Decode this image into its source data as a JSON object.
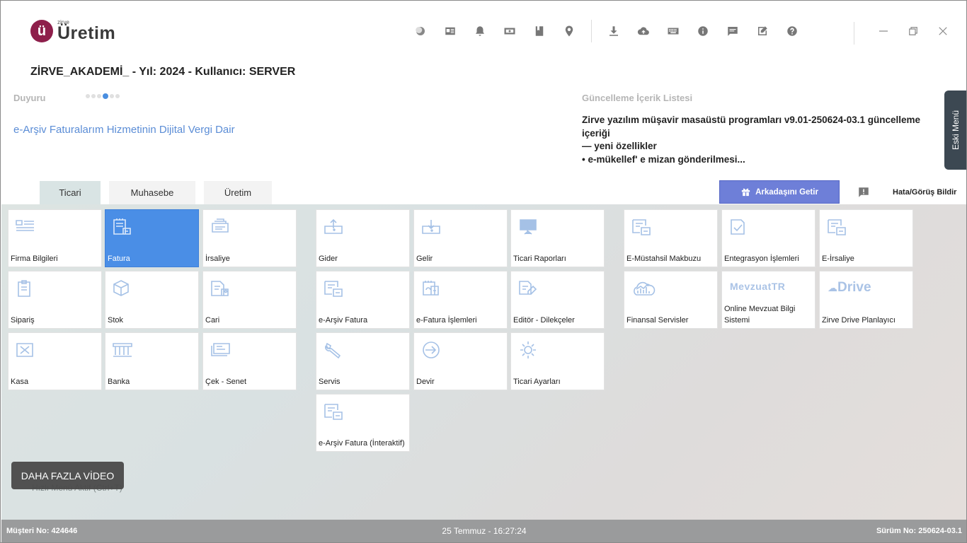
{
  "app": {
    "logo_small": "zirve",
    "logo_main": "Üretim",
    "logo_badge": "ü"
  },
  "topbar_icons": [
    "theme-icon",
    "news-icon",
    "bell-icon",
    "money-icon",
    "bookmark-icon",
    "location-icon"
  ],
  "topbar_icons2": [
    "download-icon",
    "cloud-upload-icon",
    "keyboard-icon",
    "info-icon",
    "chat-icon",
    "edit-icon",
    "help-icon"
  ],
  "company_line": "ZİRVE_AKADEMİ_ - Yıl: 2024 - Kullanıcı: SERVER",
  "duyuru": {
    "label": "Duyuru",
    "link": "e-Arşiv Faturalarım Hizmetinin Dijital Vergi Dair"
  },
  "guncelleme": {
    "title": "Güncelleme İçerik Listesi",
    "lines": [
      "Zirve yazılım müşavir masaüstü programları v9.01-250624-03.1 güncelleme içeriği",
      "— yeni özellikler",
      "• e-mükellef' e mizan gönderilmesi..."
    ]
  },
  "eski_menu": "Eski Menü",
  "tabs": [
    "Ticari",
    "Muhasebe",
    "Üretim"
  ],
  "arkadas_button": "Arkadaşını Getir",
  "hata_link": "Hata/Görüş Bildir",
  "tiles": {
    "firma": "Firma Bilgileri",
    "fatura": "Fatura",
    "irsaliye": "İrsaliye",
    "siparis": "Sipariş",
    "stok": "Stok",
    "cari": "Cari",
    "kasa": "Kasa",
    "banka": "Banka",
    "cek": "Çek - Senet",
    "gider": "Gider",
    "gelir": "Gelir",
    "ticari_raporlar": "Ticari Raporları",
    "earsiv": "e-Arşiv Fatura",
    "efatura": "e-Fatura İşlemleri",
    "editor": "Editör - Dilekçeler",
    "servis": "Servis",
    "devir": "Devir",
    "ticari_ayarlar": "Ticari Ayarları",
    "earsiv_int": "e-Arşiv Fatura (İnteraktif)",
    "emustahsil": "E-Müstahsil Makbuzu",
    "entegrasyon": "Entegrasyon İşlemleri",
    "eirsaliye": "E-İrsaliye",
    "finansal": "Finansal Servisler",
    "mevzuat": "Online Mevzuat Bilgi Sistemi",
    "mevzuat_logo": "MevzuatTR",
    "drive": "Zirve Drive Planlayıcı",
    "drive_logo": "Drive"
  },
  "video_button": "DAHA FAZLA VİDEO",
  "hizli_menu": "Hızlı Menü Aktif (Ctrl+T)",
  "status": {
    "musteri": "Müşteri No: 424646",
    "datetime": "25 Temmuz - 16:27:24",
    "surum": "Sürüm No: 250624-03.1"
  },
  "colors": {
    "brand": "#8e1f4b",
    "accent": "#4a8ee6",
    "button": "#6e7fd8",
    "status_bar": "#9a9b9c"
  }
}
